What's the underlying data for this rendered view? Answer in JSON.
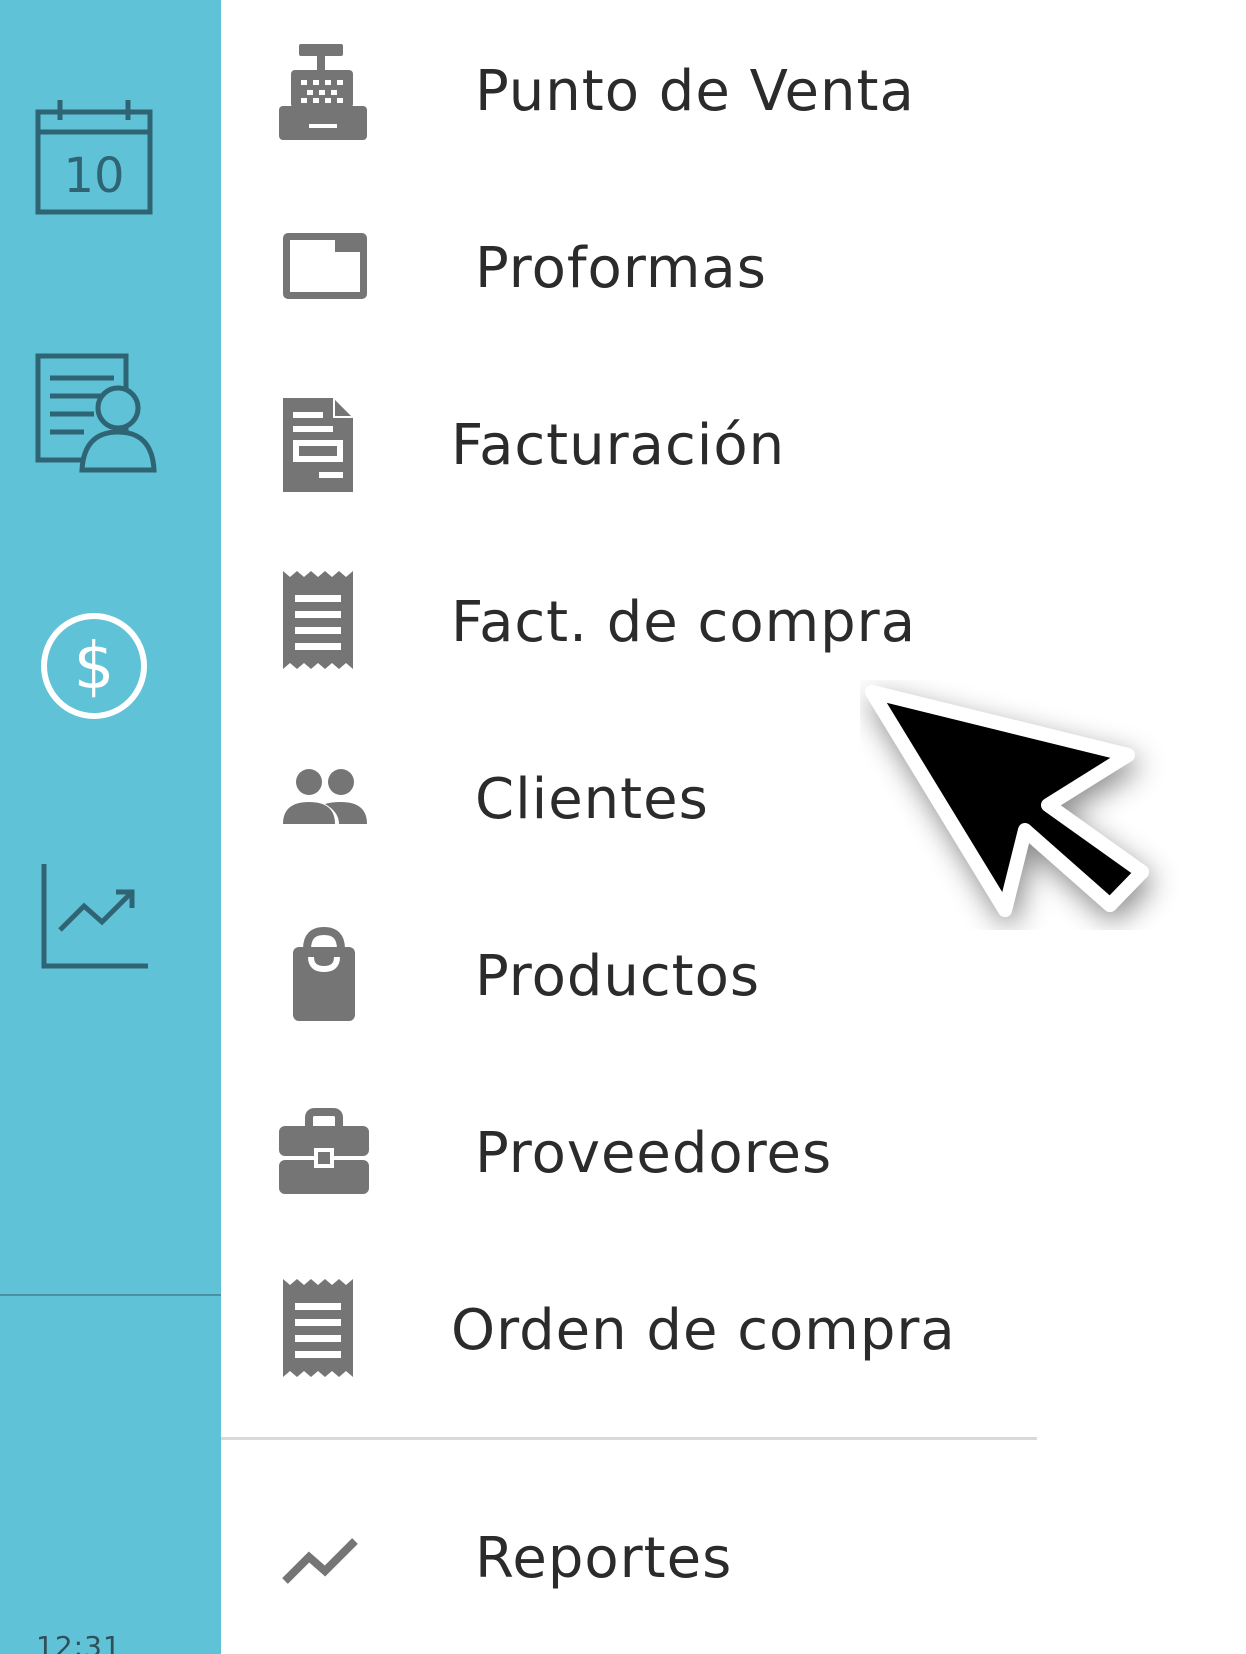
{
  "side_rail": {
    "icons": [
      "calendar-icon",
      "report-user-icon",
      "dollar-circle-icon",
      "trend-chart-icon"
    ],
    "background": "#5fc2d6",
    "icon_color": "#2f6475",
    "footer_text": "12:31"
  },
  "menu": {
    "items": [
      {
        "label": "Punto de Venta",
        "icon": "cash-register-icon"
      },
      {
        "label": "Proformas",
        "icon": "window-icon"
      },
      {
        "label": "Facturación",
        "icon": "invoice-document-icon"
      },
      {
        "label": "Fact. de compra",
        "icon": "receipt-icon"
      },
      {
        "label": "Clientes",
        "icon": "people-icon"
      },
      {
        "label": "Productos",
        "icon": "shopping-bag-icon"
      },
      {
        "label": "Proveedores",
        "icon": "briefcase-icon"
      },
      {
        "label": "Orden de compra",
        "icon": "receipt-icon"
      }
    ],
    "secondary_items": [
      {
        "label": "Reportes",
        "icon": "trending-line-icon"
      }
    ],
    "icon_color": "#757575",
    "text_color": "#2b2b2b"
  }
}
